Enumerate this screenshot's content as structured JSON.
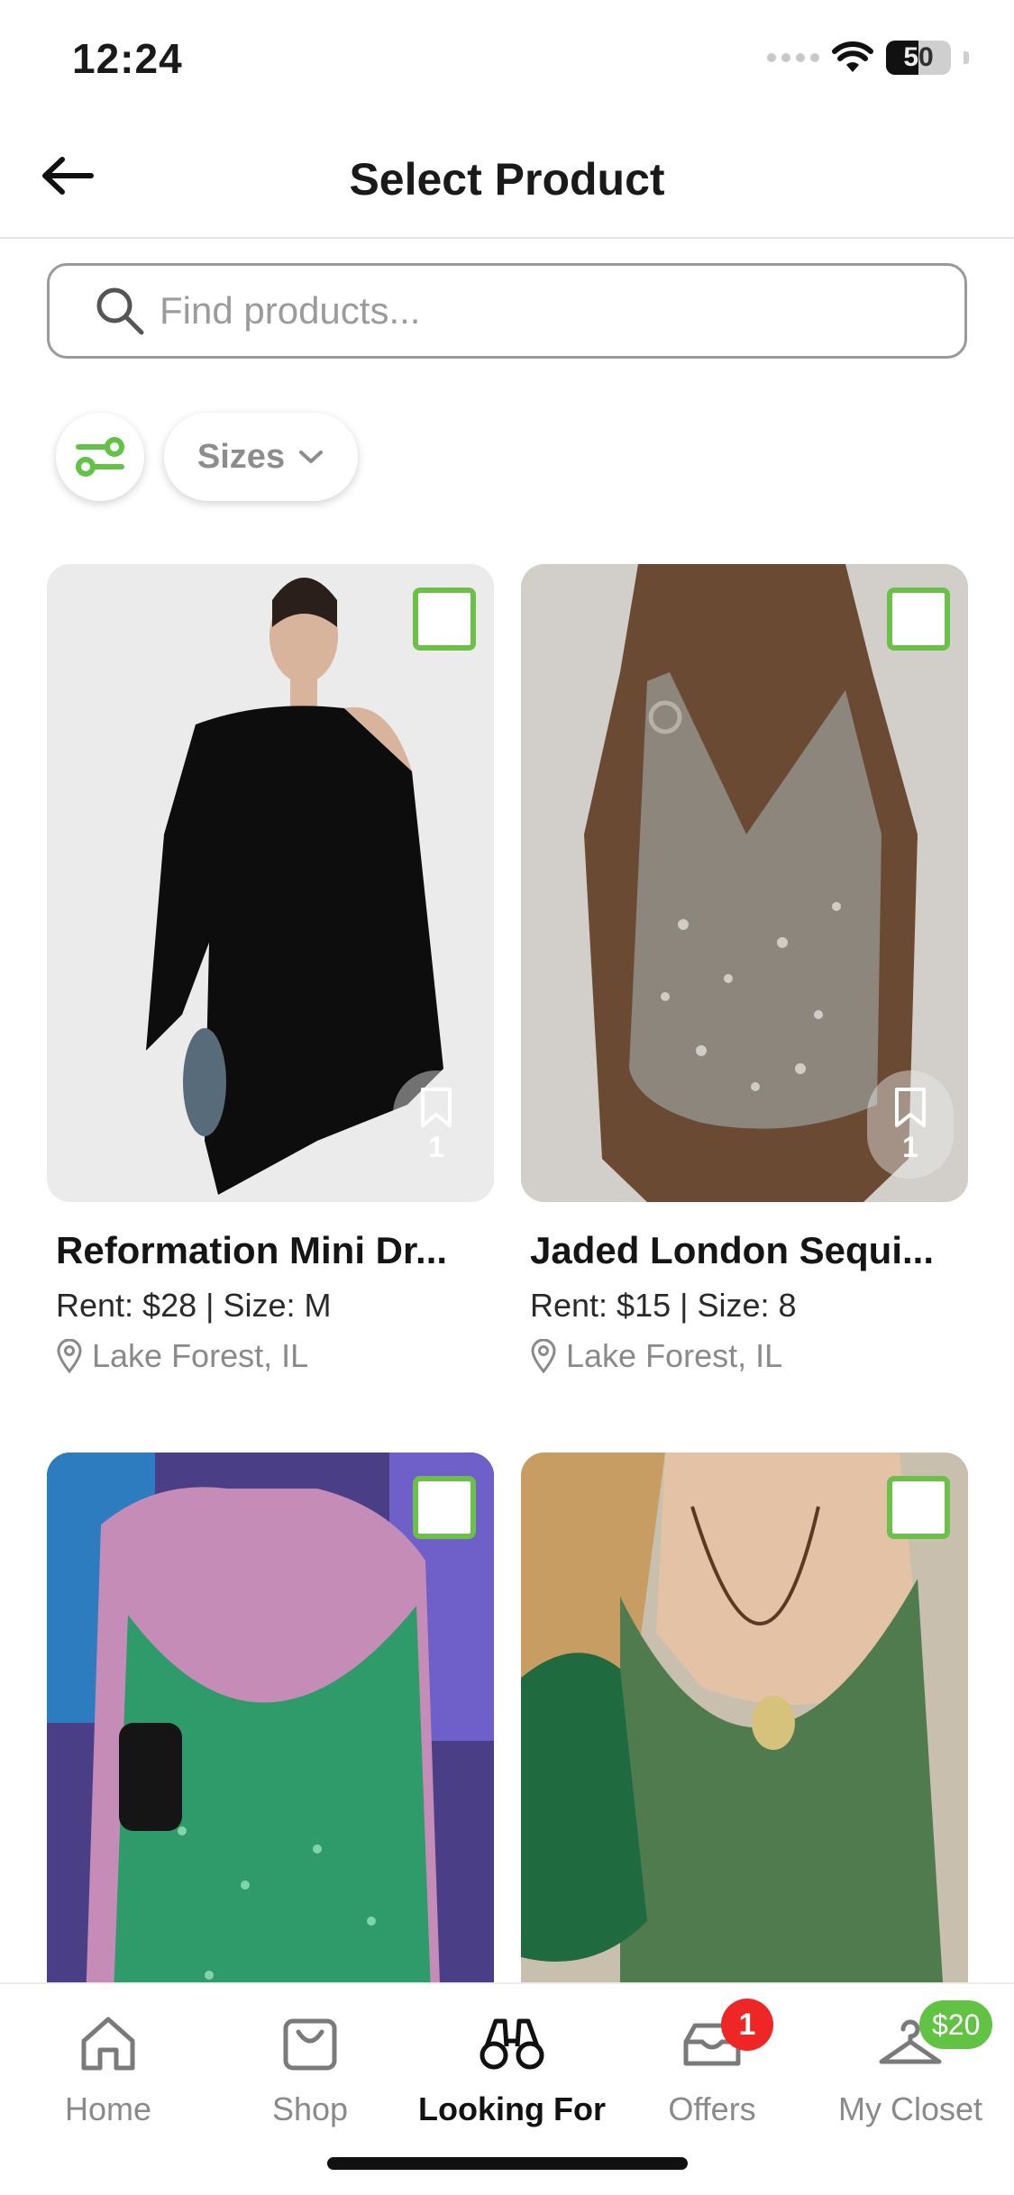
{
  "status_bar": {
    "time": "12:24",
    "battery": "50"
  },
  "header": {
    "title": "Select Product"
  },
  "search": {
    "placeholder": "Find products..."
  },
  "filters": {
    "sizes_label": "Sizes"
  },
  "products": [
    {
      "title": "Reformation Mini Dr...",
      "meta": "Rent: $28 | Size: M",
      "location": "Lake Forest, IL",
      "save_count": "1",
      "image_desc": "black-one-shoulder-dress-photo",
      "image_colors": [
        "#ececec",
        "#0d0d0d"
      ]
    },
    {
      "title": "Jaded London Sequi...",
      "meta": "Rent: $15 | Size: 8",
      "location": "Lake Forest, IL",
      "save_count": "1",
      "image_desc": "silver-sequin-dress-photo",
      "image_colors": [
        "#cfcbc6",
        "#7d776f"
      ]
    },
    {
      "image_desc": "green-sequin-dress-photo",
      "image_colors": [
        "#5d3a7a",
        "#2c8d62"
      ]
    },
    {
      "image_desc": "green-halter-top-photo",
      "image_colors": [
        "#b7ab97",
        "#4d7a4e"
      ]
    }
  ],
  "nav": {
    "home": "Home",
    "shop": "Shop",
    "looking_for": "Looking For",
    "offers": "Offers",
    "offers_badge": "1",
    "my_closet": "My Closet",
    "closet_badge": "$20"
  },
  "colors": {
    "accent_green": "#6cc04a",
    "badge_red": "#ee2626",
    "badge_green": "#62c244"
  }
}
